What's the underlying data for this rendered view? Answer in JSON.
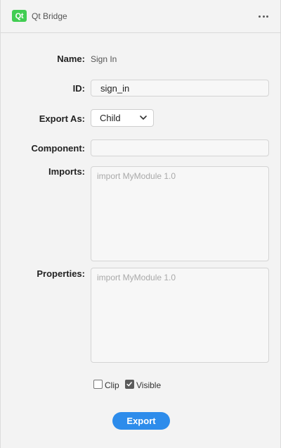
{
  "header": {
    "logo_text": "Qt",
    "title": "Qt Bridge",
    "more_icon": "more-horizontal-icon",
    "logo_color": "#41cd52"
  },
  "form": {
    "name": {
      "label": "Name:",
      "value": "Sign In"
    },
    "id": {
      "label": "ID:",
      "value": "sign_in"
    },
    "export_as": {
      "label": "Export As:",
      "selected": "Child",
      "icon": "chevron-down-icon"
    },
    "component": {
      "label": "Component:",
      "value": ""
    },
    "imports": {
      "label": "Imports:",
      "placeholder": "import MyModule 1.0"
    },
    "properties": {
      "label": "Properties:",
      "placeholder": "import MyModule 1.0"
    }
  },
  "options": {
    "clip": {
      "label": "Clip",
      "checked": false
    },
    "visible": {
      "label": "Visible",
      "checked": true
    }
  },
  "actions": {
    "export_label": "Export",
    "accent": "#2d8ceb"
  }
}
